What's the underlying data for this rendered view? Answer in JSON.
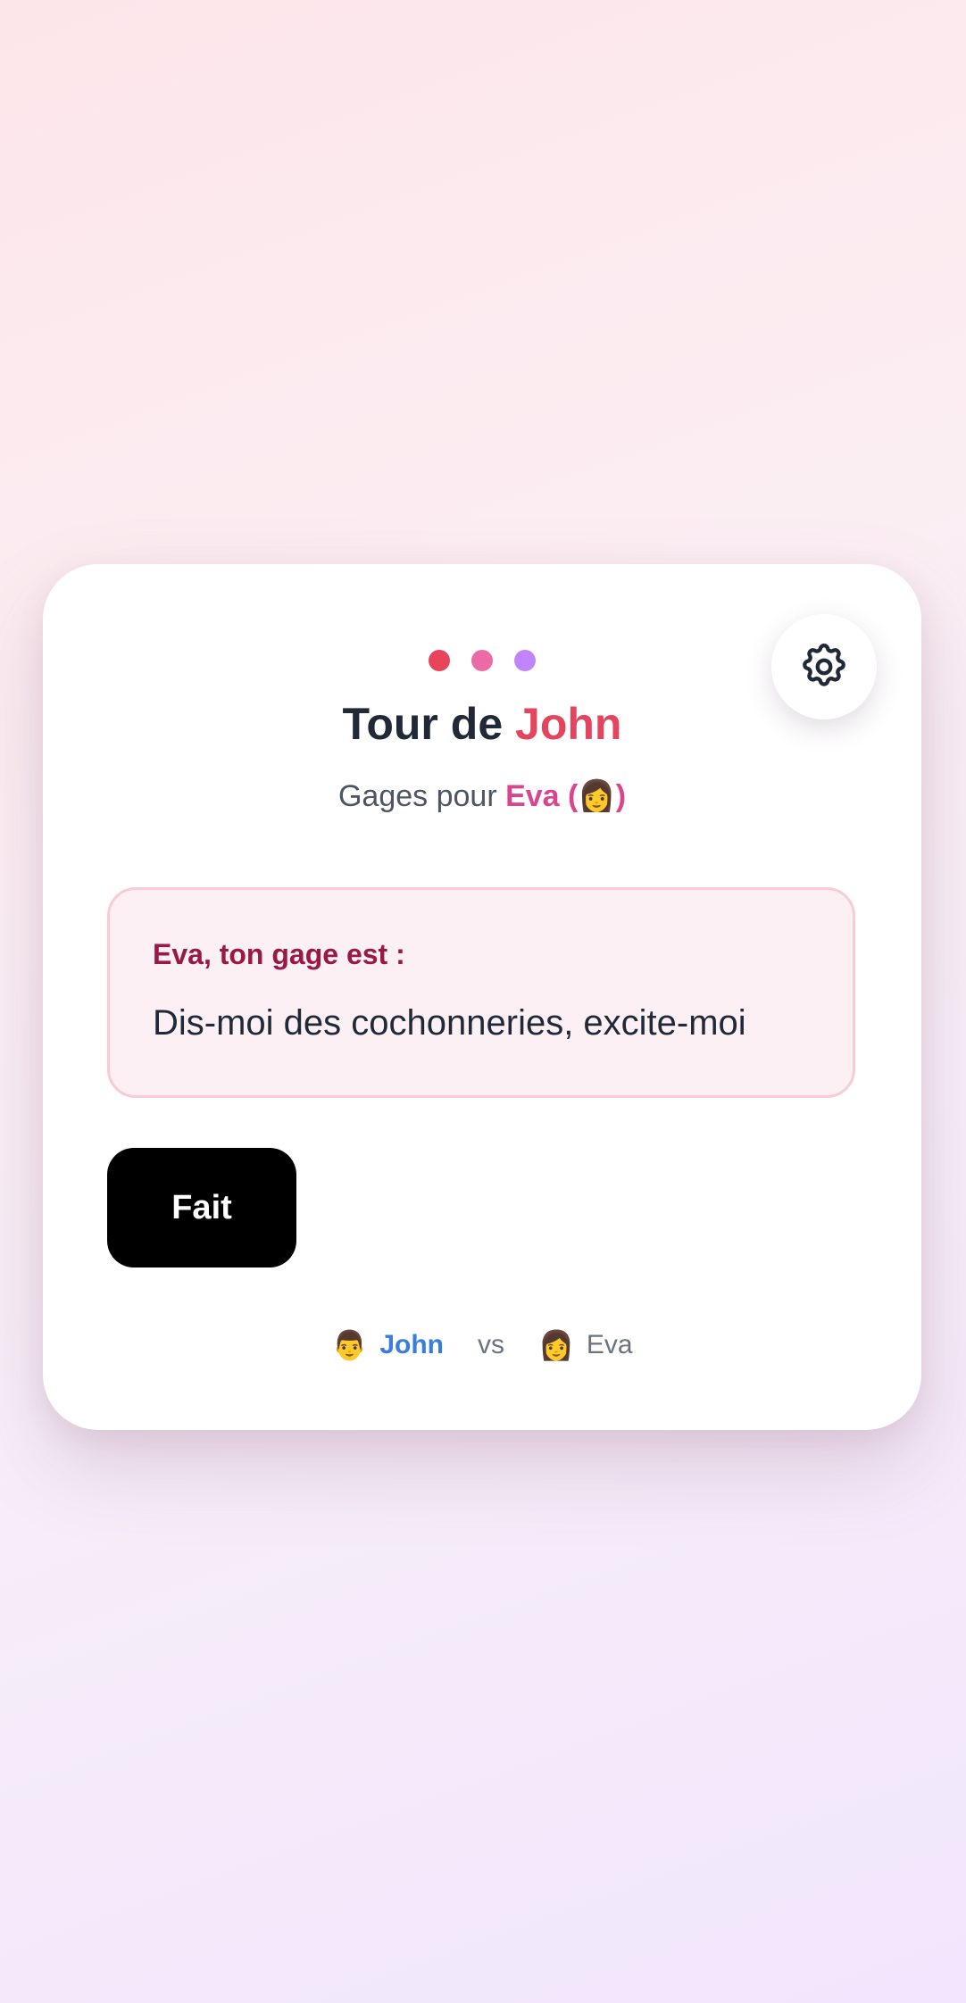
{
  "colors": {
    "dot1": "#e8445c",
    "dot2": "#ea6ba6",
    "dot3": "#c084fc",
    "accent_name": "#e3455e",
    "target_name": "#d9458f",
    "current_player": "#3b7ddd"
  },
  "header": {
    "title_prefix": "Tour de ",
    "title_name": "John",
    "subtitle_prefix": "Gages pour ",
    "subtitle_target": "Eva (👩)",
    "settings_icon": "gear-icon"
  },
  "gage": {
    "label": "Eva, ton gage est :",
    "text": "Dis-moi des cochonneries, excite-moi"
  },
  "actions": {
    "done_label": "Fait"
  },
  "players": {
    "p1_emoji": "👨",
    "p1_name": "John",
    "vs": "vs",
    "p2_emoji": "👩",
    "p2_name": "Eva"
  }
}
